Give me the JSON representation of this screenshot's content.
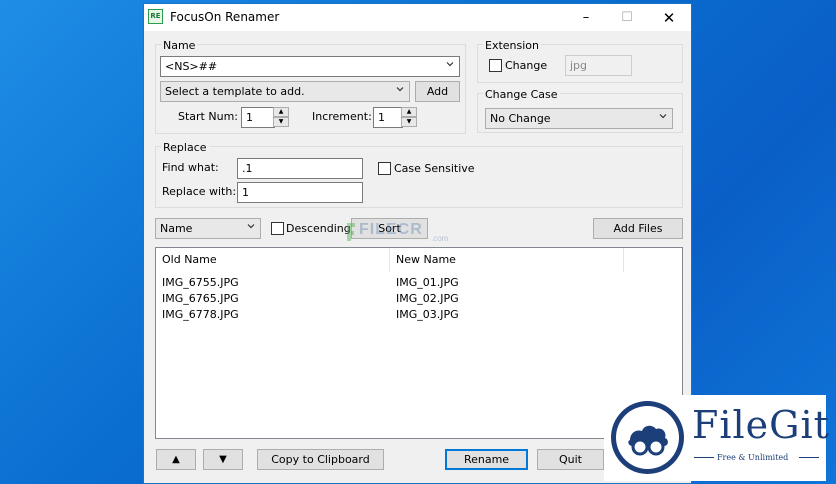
{
  "window": {
    "title": "FocusOn Renamer",
    "icon_text": "RE"
  },
  "name_group": {
    "label": "Name",
    "template_value": "<NS>##",
    "template_select_placeholder": "Select a template to add.",
    "add_label": "Add",
    "start_num_label": "Start Num:",
    "start_num_value": "1",
    "increment_label": "Increment:",
    "increment_value": "1"
  },
  "extension_group": {
    "label": "Extension",
    "change_label": "Change",
    "change_checked": false,
    "ext_value": "jpg"
  },
  "change_case_group": {
    "label": "Change Case",
    "selected": "No Change"
  },
  "replace_group": {
    "label": "Replace",
    "find_label": "Find what:",
    "find_value": ".1",
    "replace_label": "Replace with:",
    "replace_value": "1",
    "case_sensitive_label": "Case Sensitive",
    "case_sensitive_checked": false
  },
  "sort_bar": {
    "sort_by": "Name",
    "descending_label": "Descending",
    "sort_label": "Sort",
    "add_files_label": "Add Files"
  },
  "file_list": {
    "columns": [
      "Old Name",
      "New Name"
    ],
    "rows": [
      {
        "old": "IMG_6755.JPG",
        "new": "IMG_01.JPG"
      },
      {
        "old": "IMG_6765.JPG",
        "new": "IMG_02.JPG"
      },
      {
        "old": "IMG_6778.JPG",
        "new": "IMG_03.JPG"
      }
    ]
  },
  "bottom_bar": {
    "up_label": "▲",
    "down_label": "▼",
    "copy_label": "Copy to Clipboard",
    "rename_label": "Rename",
    "quit_label": "Quit"
  },
  "watermarks": {
    "filecr": "FILECR",
    "filecr_suffix": ".com",
    "filegit_name": "FileGit",
    "filegit_tagline": "Free & Unlimited"
  },
  "colors": {
    "accent": "#0078d7",
    "desktop": "#0a6fd1",
    "filegit_blue": "#1c3f7a"
  }
}
